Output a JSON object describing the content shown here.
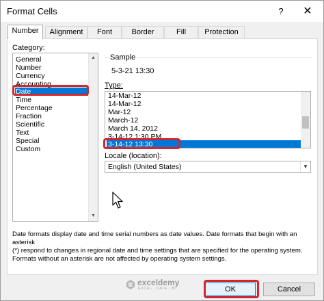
{
  "window": {
    "title": "Format Cells",
    "help_label": "?",
    "close_glyph": "✕"
  },
  "tabs": [
    {
      "label": "Number",
      "active": true
    },
    {
      "label": "Alignment",
      "active": false
    },
    {
      "label": "Font",
      "active": false
    },
    {
      "label": "Border",
      "active": false
    },
    {
      "label": "Fill",
      "active": false
    },
    {
      "label": "Protection",
      "active": false
    }
  ],
  "category": {
    "label": "Category:",
    "items": [
      "General",
      "Number",
      "Currency",
      "Accounting",
      "Date",
      "Time",
      "Percentage",
      "Fraction",
      "Scientific",
      "Text",
      "Special",
      "Custom"
    ],
    "selected": "Date"
  },
  "sample": {
    "label": "Sample",
    "value": "5-3-21 13:30"
  },
  "type": {
    "label": "Type:",
    "items": [
      "14-Mar-12",
      "14-Mar-12",
      "Mar-12",
      "March-12",
      "March 14, 2012",
      "3-14-12 1:30 PM",
      "3-14-12 13:30"
    ],
    "selected": "3-14-12 13:30"
  },
  "locale": {
    "label": "Locale (location):",
    "value": "English (United States)"
  },
  "description": {
    "line1": "Date formats display date and time serial numbers as date values.  Date formats that begin with an asterisk",
    "line2": "(*) respond to changes in regional date and time settings that are specified for the operating system.",
    "line3": "Formats without an asterisk are not affected by operating system settings."
  },
  "watermark": {
    "name": "exceldemy",
    "tagline": "EXCEL · DATA · BI"
  },
  "buttons": {
    "ok": "OK",
    "cancel": "Cancel"
  },
  "colors": {
    "selection": "#0078d7",
    "highlight_box": "#d3252e"
  },
  "icons": [
    "close-icon",
    "scroll-up-arrow-icon",
    "scroll-down-arrow-icon",
    "dropdown-arrow-icon",
    "mouse-cursor-icon",
    "exceldemy-logo-icon"
  ]
}
